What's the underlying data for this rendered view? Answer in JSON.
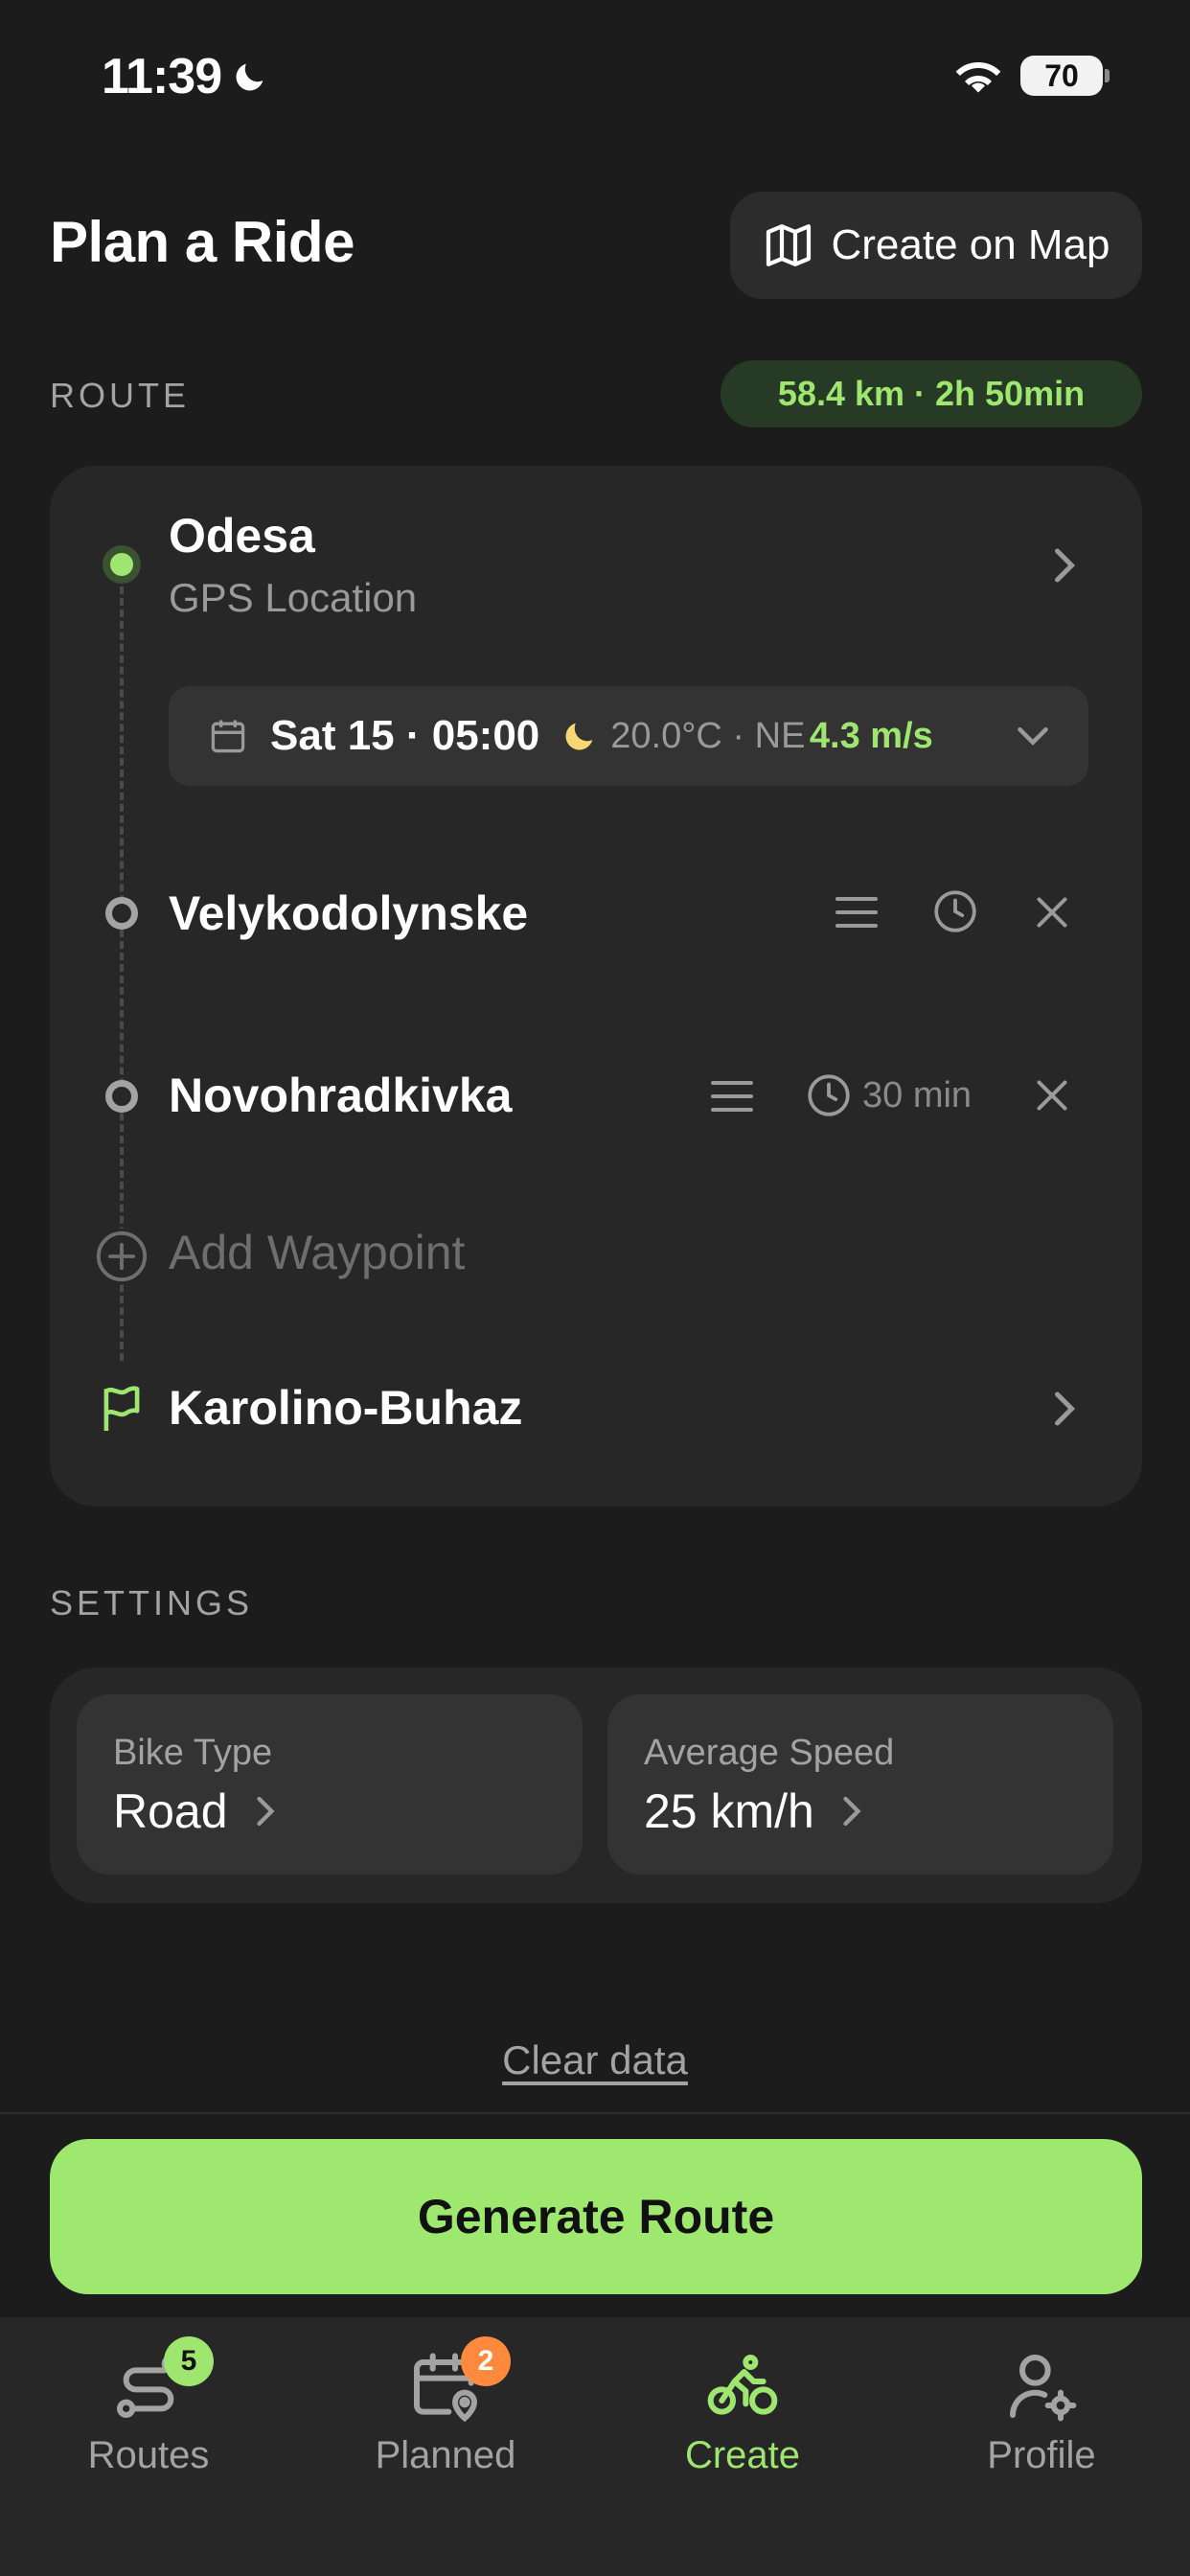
{
  "status_bar": {
    "time": "11:39",
    "battery": "70"
  },
  "header": {
    "title": "Plan a Ride",
    "map_button_label": "Create on Map"
  },
  "route": {
    "section_label": "ROUTE",
    "summary": "58.4 km · 2h 50min",
    "start": {
      "name": "Odesa",
      "subtitle": "GPS Location"
    },
    "departure": {
      "datetime": "Sat 15 · 05:00",
      "weather": "20.0°C · NE",
      "wind": "4.3 m/s"
    },
    "waypoints": [
      {
        "name": "Velykodolynske",
        "stop_time": ""
      },
      {
        "name": "Novohradkivka",
        "stop_time": "30 min"
      }
    ],
    "add_waypoint_label": "Add Waypoint",
    "destination": {
      "name": "Karolino-Buhaz"
    }
  },
  "settings": {
    "section_label": "SETTINGS",
    "bike_type": {
      "label": "Bike Type",
      "value": "Road"
    },
    "average_speed": {
      "label": "Average Speed",
      "value": "25 km/h"
    }
  },
  "clear_label": "Clear data",
  "generate_label": "Generate Route",
  "tabs": [
    {
      "label": "Routes",
      "badge": "5",
      "badge_color": "#9ee66f"
    },
    {
      "label": "Planned",
      "badge": "2",
      "badge_color": "#ff8a3d"
    },
    {
      "label": "Create",
      "badge": ""
    },
    {
      "label": "Profile",
      "badge": ""
    }
  ],
  "colors": {
    "accent": "#9ee66f",
    "background": "#1c1c1c",
    "card": "#272727"
  }
}
